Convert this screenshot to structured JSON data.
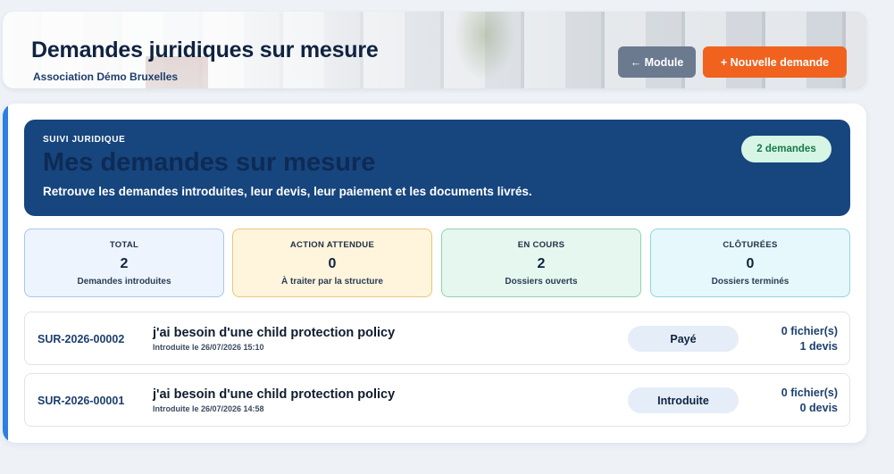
{
  "header": {
    "title": "Demandes juridiques sur mesure",
    "subtitle": "Association Démo Bruxelles",
    "module_button": "← Module",
    "new_button": "+ Nouvelle demande"
  },
  "hero": {
    "kicker": "SUIVI JURIDIQUE",
    "title": "Mes demandes sur mesure",
    "description": "Retrouve les demandes introduites, leur devis, leur paiement et les documents livrés.",
    "count_badge": "2 demandes"
  },
  "stats": [
    {
      "label": "TOTAL",
      "value": "2",
      "sub": "Demandes introduites"
    },
    {
      "label": "ACTION ATTENDUE",
      "value": "0",
      "sub": "À traiter par la structure"
    },
    {
      "label": "EN COURS",
      "value": "2",
      "sub": "Dossiers ouverts"
    },
    {
      "label": "CLÔTURÉES",
      "value": "0",
      "sub": "Dossiers terminés"
    }
  ],
  "requests": [
    {
      "ref": "SUR-2026-00002",
      "title": "j'ai besoin d'une child protection policy",
      "date": "Introduite le 26/07/2026 15:10",
      "status": "Payé",
      "files": "0 fichier(s)",
      "quotes": "1 devis"
    },
    {
      "ref": "SUR-2026-00001",
      "title": "j'ai besoin d'une child protection policy",
      "date": "Introduite le 26/07/2026 14:58",
      "status": "Introduite",
      "files": "0 fichier(s)",
      "quotes": "0 devis"
    }
  ],
  "colors": {
    "hero_bg": "#17457e",
    "accent_orange": "#f0621e",
    "module_gray": "#6b7a8f",
    "badge_green_bg": "#d7f5e5",
    "badge_green_text": "#17794a",
    "left_bar_blue": "#2f7fe0"
  }
}
